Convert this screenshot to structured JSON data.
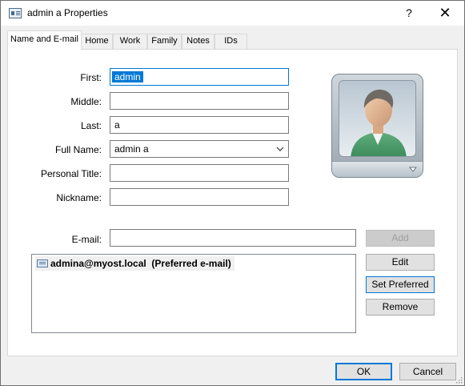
{
  "window": {
    "title": "admin a Properties",
    "help": "?",
    "close": "✕"
  },
  "tabs": [
    {
      "label": "Name and E-mail",
      "active": true
    },
    {
      "label": "Home"
    },
    {
      "label": "Work"
    },
    {
      "label": "Family"
    },
    {
      "label": "Notes"
    },
    {
      "label": "IDs"
    }
  ],
  "form": {
    "first_label": "First:",
    "first_value": "admin",
    "middle_label": "Middle:",
    "middle_value": "",
    "last_label": "Last:",
    "last_value": "a",
    "fullname_label": "Full Name:",
    "fullname_value": "admin a",
    "title_label": "Personal Title:",
    "title_value": "",
    "nickname_label": "Nickname:",
    "nickname_value": ""
  },
  "email": {
    "label": "E-mail:",
    "value": "",
    "items": [
      {
        "address": "admina@myost.local",
        "note": "(Preferred e-mail)"
      }
    ],
    "add": "Add",
    "edit": "Edit",
    "set_preferred": "Set Preferred",
    "remove": "Remove"
  },
  "footer": {
    "ok": "OK",
    "cancel": "Cancel"
  },
  "icons": {
    "title": "contact-card-icon",
    "avatar": "contact-avatar-icon",
    "dropdown": "chevron-down-icon",
    "email": "email-entry-icon"
  },
  "colors": {
    "accent": "#0078d7",
    "window_bg": "#f0f0f0"
  }
}
